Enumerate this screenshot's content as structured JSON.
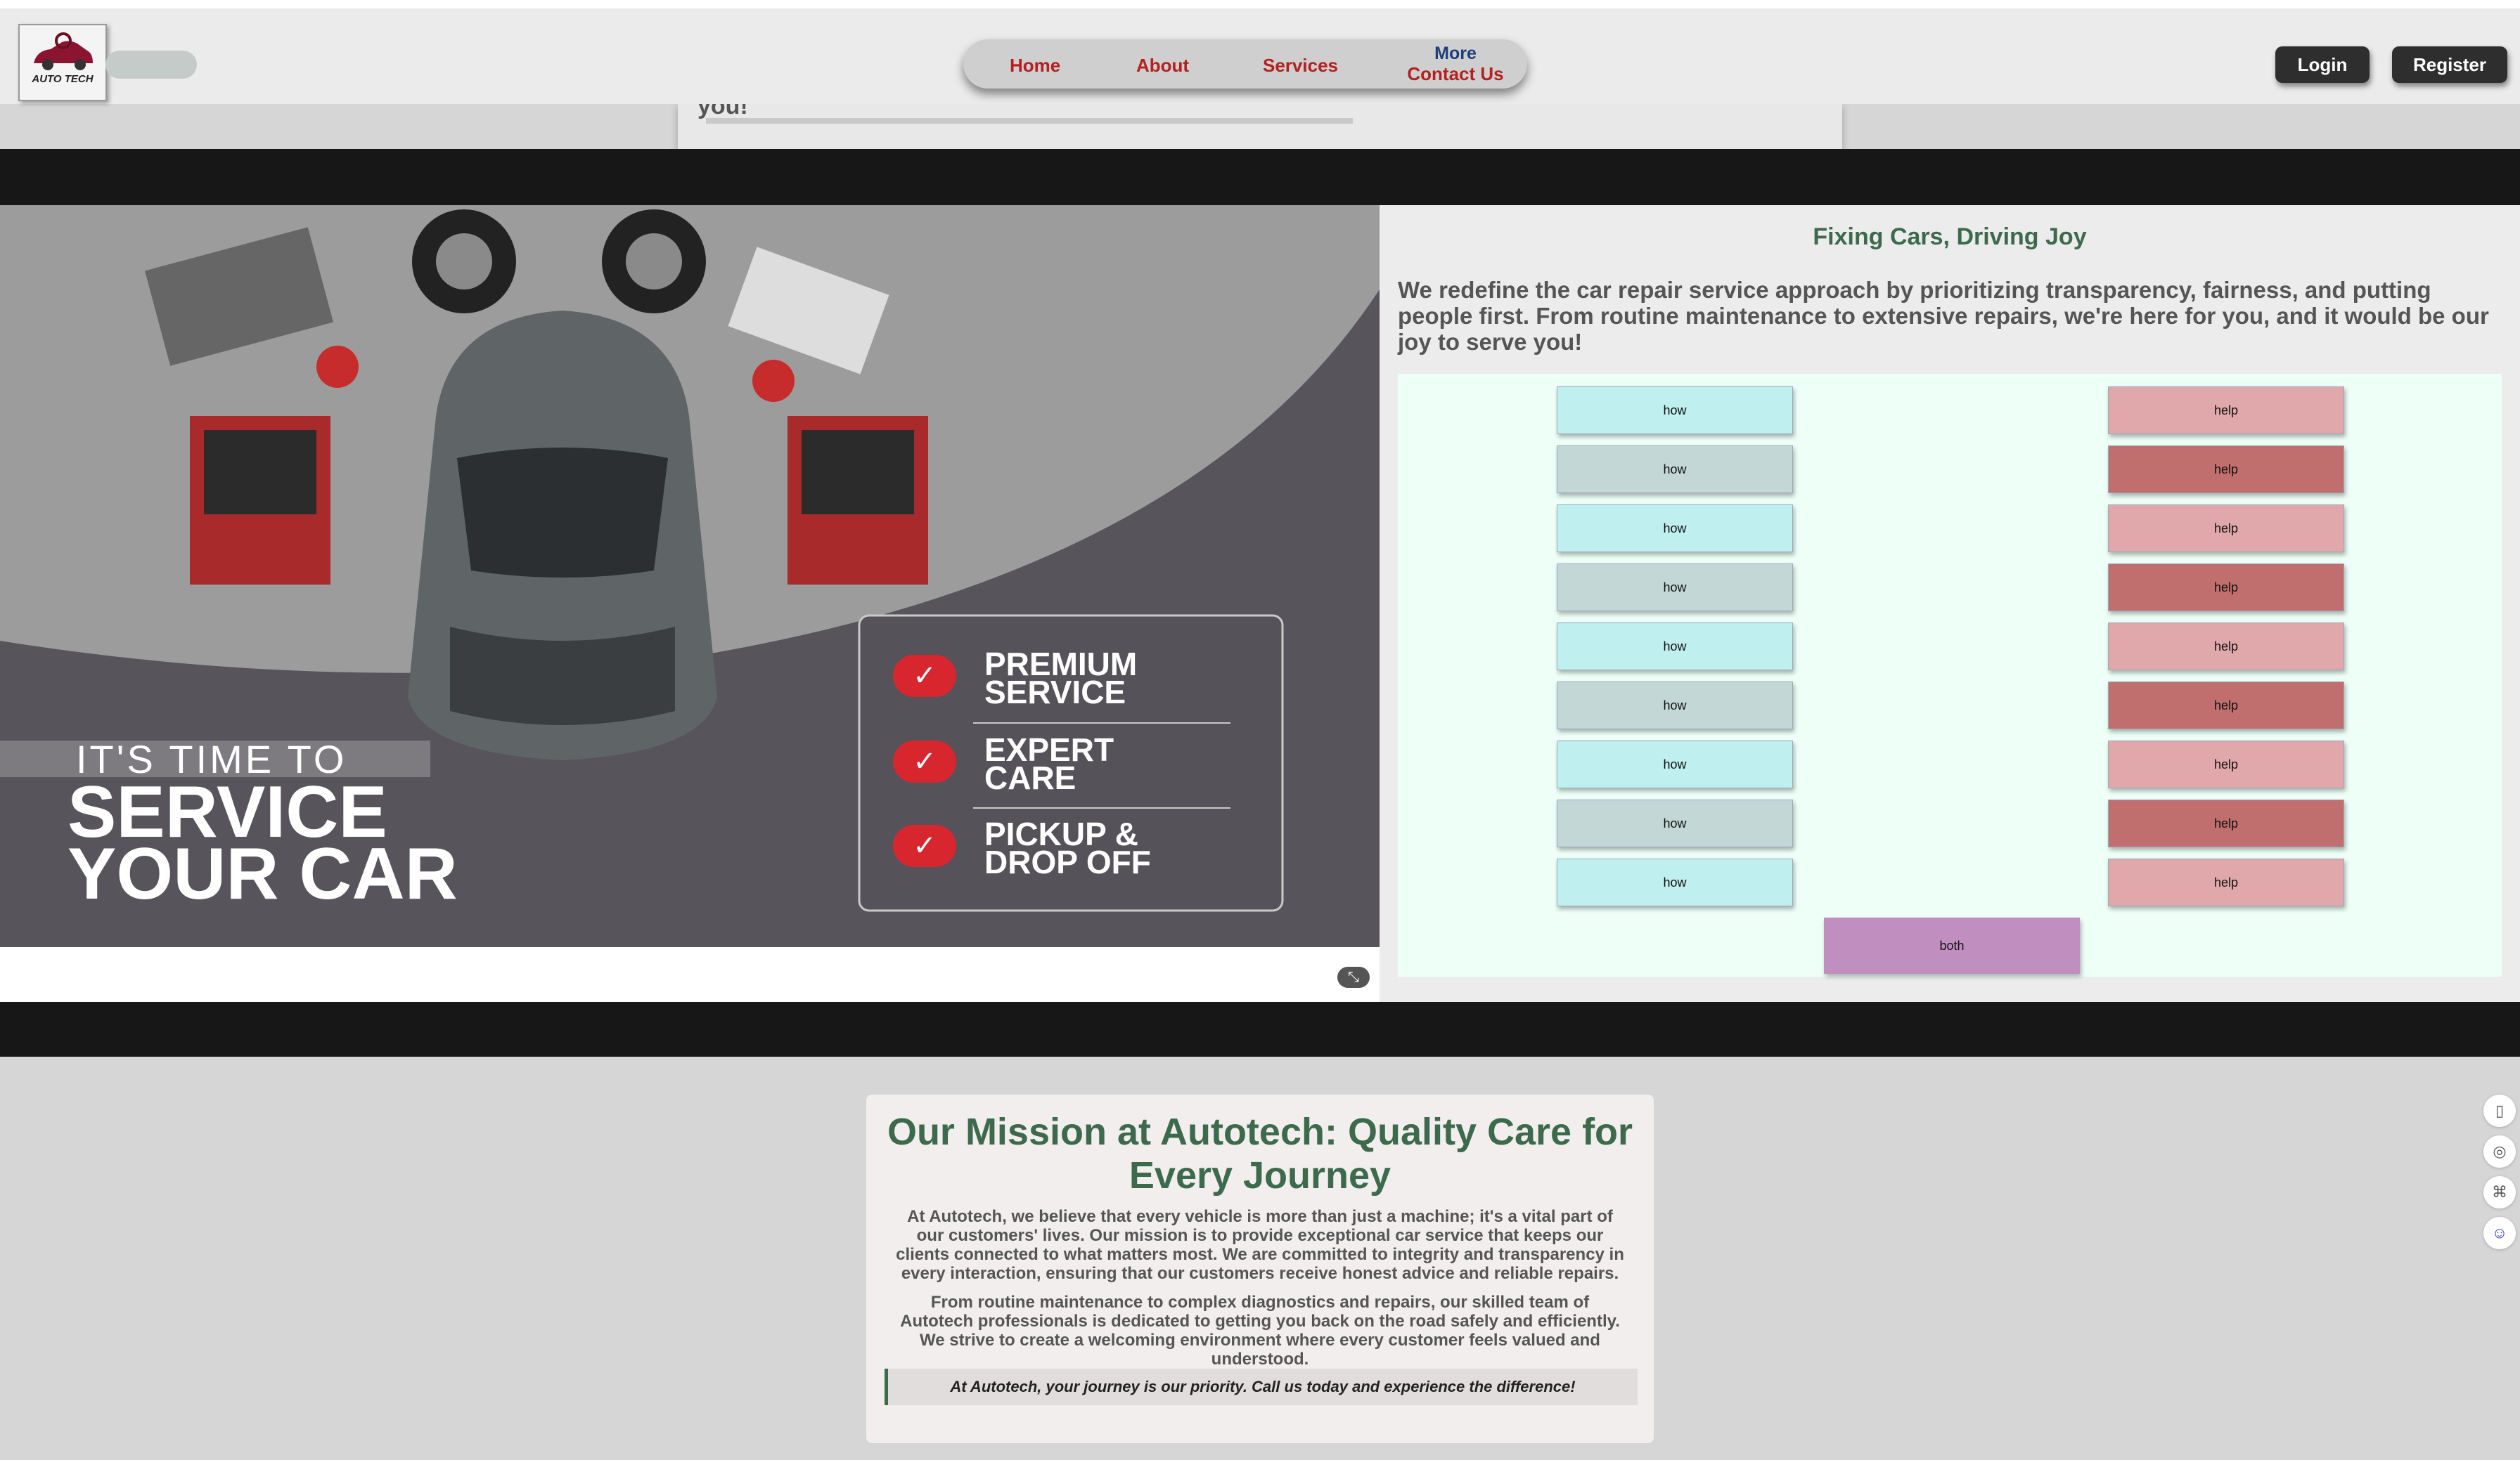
{
  "header": {
    "logo_text": "AUTO TECH",
    "nav": {
      "home": "Home",
      "about": "About",
      "services": "Services",
      "more": "More",
      "contact": "Contact Us"
    },
    "login_label": "Login",
    "register_label": "Register"
  },
  "overlap_text": "you!",
  "hero": {
    "tagline_small": "IT'S TIME TO",
    "tagline_line1": "SERVICE",
    "tagline_line2": "YOUR CAR",
    "features": [
      {
        "line1": "PREMIUM",
        "line2": "SERVICE"
      },
      {
        "line1": "EXPERT",
        "line2": "CARE"
      },
      {
        "line1": "PICKUP &",
        "line2": "DROP OFF"
      }
    ]
  },
  "right_panel": {
    "title": "Fixing Cars, Driving Joy",
    "text": "We redefine the car repair service approach by prioritizing transparency, fairness, and putting people first. From routine maintenance to extensive repairs, we're here for you, and it would be our joy to serve you!",
    "how_label": "how",
    "help_label": "help",
    "both_label": "both",
    "colors": {
      "how_light": "#c0efef",
      "how_dark": "#c3d8d6",
      "help_light": "#e0a8aa",
      "help_dark": "#c06e6e",
      "both": "#c18fbf"
    }
  },
  "mission": {
    "title": "Our Mission at Autotech: Quality Care for Every Journey",
    "p1": "At Autotech, we believe that every vehicle is more than just a machine; it's a vital part of our customers' lives. Our mission is to provide exceptional car service that keeps our clients connected to what matters most. We are committed to integrity and transparency in every interaction, ensuring that our customers receive honest advice and reliable repairs.",
    "p2": "From routine maintenance to complex diagnostics and repairs, our skilled team of Autotech professionals is dedicated to getting you back on the road safely and efficiently. We strive to create a welcoming environment where every customer feels valued and understood.",
    "quote": "At Autotech, your journey is our priority. Call us today and experience the difference!"
  },
  "side_icons": [
    "book-icon",
    "fingerprint-icon",
    "command-icon",
    "face-icon"
  ]
}
